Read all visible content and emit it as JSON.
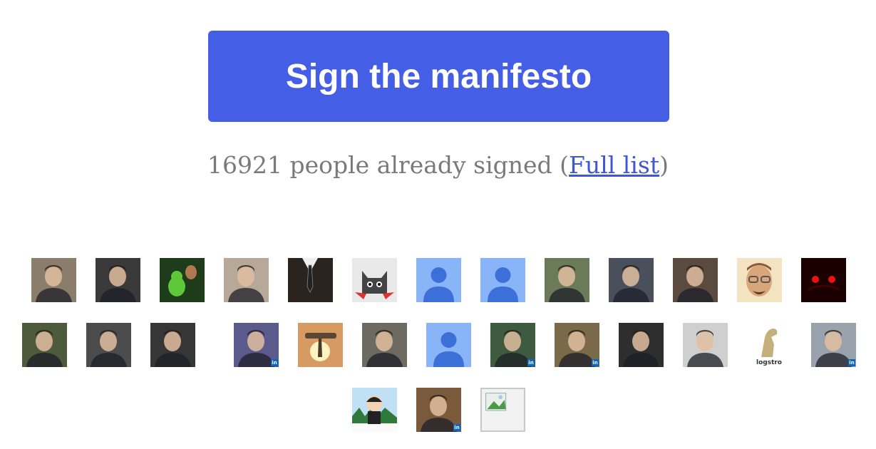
{
  "cta": {
    "label": "Sign the manifesto"
  },
  "signers": {
    "count": "16921",
    "text": " people already signed (",
    "link": "Full list",
    "close": ")"
  },
  "avatars": {
    "row1": [
      {
        "name": "avatar-photo-family",
        "bg": "#8b7d6b"
      },
      {
        "name": "avatar-photo-bw-face",
        "bg": "#3a3a3a"
      },
      {
        "name": "avatar-photo-green-toy",
        "bg": "#1e3b1a"
      },
      {
        "name": "avatar-photo-baby",
        "bg": "#b7a999"
      },
      {
        "name": "avatar-photo-suit-tie",
        "bg": "#2b231d"
      },
      {
        "name": "avatar-cartoon-cat",
        "bg": "#e9e9e9"
      },
      {
        "name": "avatar-default-person",
        "bg": "#8ab4f8"
      },
      {
        "name": "avatar-default-person",
        "bg": "#8ab4f8"
      },
      {
        "name": "avatar-photo-man-smiling",
        "bg": "#6b7b5a"
      },
      {
        "name": "avatar-photo-man-dark",
        "bg": "#4a4f5c"
      },
      {
        "name": "avatar-photo-man-glasses",
        "bg": "#5a4a40"
      },
      {
        "name": "avatar-cartoon-man-glasses",
        "bg": "#f4e3c1"
      },
      {
        "name": "avatar-android-red-eyes",
        "bg": "#1b0000"
      }
    ],
    "row2": [
      {
        "name": "avatar-photo-man-glasses",
        "bg": "#4e5a3c",
        "linkedin": false
      },
      {
        "name": "avatar-photo-man-bw",
        "bg": "#4c4c4c",
        "linkedin": false
      },
      {
        "name": "avatar-photo-man-bw",
        "bg": "#363636",
        "linkedin": false
      },
      {
        "name": "avatar-photo-man",
        "bg": "#5b5a8c",
        "linkedin": true
      },
      {
        "name": "avatar-photo-sunset-rock",
        "bg": "#d79a63",
        "linkedin": false
      },
      {
        "name": "avatar-photo-man-face",
        "bg": "#6d6a62",
        "linkedin": false
      },
      {
        "name": "avatar-default-person",
        "bg": "#8ab4f8",
        "linkedin": false
      },
      {
        "name": "avatar-photo-man-sunglasses",
        "bg": "#3f5b3f",
        "linkedin": true
      },
      {
        "name": "avatar-photo-man-suit",
        "bg": "#7a6a4a",
        "linkedin": true
      },
      {
        "name": "avatar-photo-man-bw",
        "bg": "#2e2e2e",
        "linkedin": false
      },
      {
        "name": "avatar-photo-man-white-shirt",
        "bg": "#cfcfcf",
        "linkedin": false
      },
      {
        "name": "avatar-dinosaur-logo",
        "bg": "#ffffff",
        "linkedin": false,
        "caption": "logstro"
      },
      {
        "name": "avatar-photo-man-grey-hair",
        "bg": "#9aa3ad",
        "linkedin": true
      }
    ],
    "row3": [
      {
        "name": "avatar-cartoon-character",
        "bg": "#bfe0f5",
        "linkedin": false
      },
      {
        "name": "avatar-photo-man",
        "bg": "#7b5a3c",
        "linkedin": true
      },
      {
        "name": "avatar-broken-image",
        "bg": "#f2f2f2",
        "linkedin": false
      }
    ],
    "linkedin_badge": "in"
  },
  "colors": {
    "cta_bg": "#445fe6",
    "cta_text": "#ffffff",
    "count_text": "#7a7a7a",
    "link": "#3f57d6",
    "linkedin": "#0a66c2"
  }
}
